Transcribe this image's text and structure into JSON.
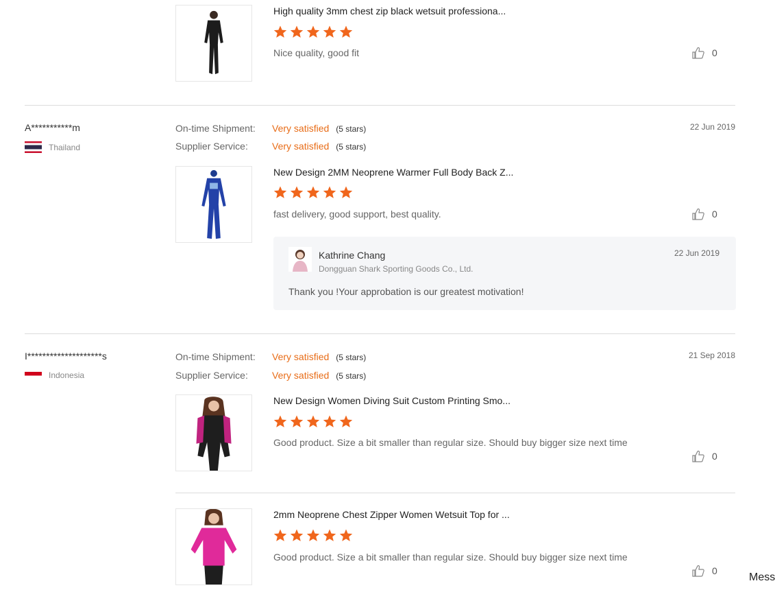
{
  "reviews": [
    {
      "product_title": "High quality 3mm chest zip black wetsuit professiona...",
      "product_rating": 5,
      "comment": "Nice quality, good fit",
      "likes": "0"
    },
    {
      "buyer": "A***********m",
      "country": "Thailand",
      "date": "22 Jun 2019",
      "shipment_label": "On-time Shipment:",
      "shipment_value": "Very satisfied",
      "shipment_stars": "(5 stars)",
      "service_label": "Supplier Service:",
      "service_value": "Very satisfied",
      "service_stars": "(5 stars)",
      "product_title": "New Design 2MM Neoprene Warmer Full Body Back Z...",
      "product_rating": 5,
      "comment": "fast delivery, good support, best quality.",
      "likes": "0",
      "reply": {
        "name": "Kathrine Chang",
        "company": "Dongguan Shark Sporting Goods Co., Ltd.",
        "date": "22 Jun 2019",
        "text": "Thank you !Your approbation is our greatest motivation!"
      }
    },
    {
      "buyer": "I********************s",
      "country": "Indonesia",
      "date": "21 Sep 2018",
      "shipment_label": "On-time Shipment:",
      "shipment_value": "Very satisfied",
      "shipment_stars": "(5 stars)",
      "service_label": "Supplier Service:",
      "service_value": "Very satisfied",
      "service_stars": "(5 stars)",
      "items": [
        {
          "product_title": "New Design Women Diving Suit Custom Printing Smo...",
          "product_rating": 5,
          "comment": "Good product. Size a bit smaller than regular size. Should buy bigger size next time",
          "likes": "0"
        },
        {
          "product_title": "2mm Neoprene Chest Zipper Women Wetsuit Top for ...",
          "product_rating": 5,
          "comment": "Good product. Size a bit smaller than regular size. Should buy bigger size next time",
          "likes": "0"
        }
      ]
    }
  ],
  "messenger_label": "Mess",
  "colors": {
    "accent": "#e86c17",
    "star": "#f0661c"
  },
  "icons": {
    "star": "star-icon",
    "like": "thumbs-up-icon"
  }
}
